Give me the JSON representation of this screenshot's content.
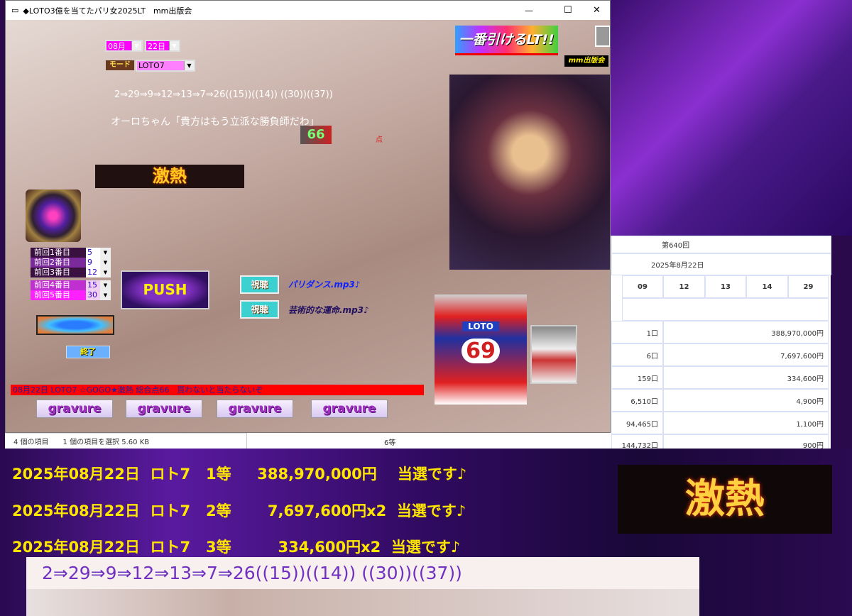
{
  "window": {
    "title": "◆LOTO3億を当てたパリ女2025LT　mm出版会",
    "minimize": "—",
    "maximize": "☐",
    "close": "✕"
  },
  "controls": {
    "month": "08月",
    "day": "22日",
    "mode_label": "モード",
    "mode": "LOTO7"
  },
  "sequence_text": "2⇒29⇒9⇒12⇒13⇒7⇒26((15))((14)) ((30))((37))",
  "speech": "オーロちゃん「貴方はもう立派な勝負師だわ」",
  "score": {
    "value": "66",
    "unit": "点"
  },
  "banner_hot": "激熱",
  "logo": {
    "text": "一番引けるLT!!",
    "publisher": "mm出版会"
  },
  "previous": [
    {
      "label": "前回1番目",
      "value": "5",
      "color": "#3a1040"
    },
    {
      "label": "前回2番目",
      "value": "9",
      "color": "#7a2a9a"
    },
    {
      "label": "前回3番目",
      "value": "12",
      "color": "#3a1040"
    },
    {
      "label": "前回4番目",
      "value": "15",
      "color": "#c030d0"
    },
    {
      "label": "前回5番目",
      "value": "30",
      "color": "#ff20ff"
    }
  ],
  "push_label": "PUSH",
  "listen": [
    {
      "button": "視聴",
      "track": "パリダンス.mp3♪"
    },
    {
      "button": "視聴",
      "track": "芸術的な運命.mp3♪"
    }
  ],
  "exit_label": "終了",
  "ticker": "08月22日 LOTO7 ☆GOGO★激熱 総合点66　買わないと当たらないぞ",
  "gravure": [
    "gravure",
    "gravure",
    "gravure",
    "gravure"
  ],
  "slot_text": "LOTO",
  "slot_number": "69",
  "status_bar": {
    "items": "4 個の項目",
    "selected": "1 個の項目を選択  5.60 KB"
  },
  "results": {
    "round": "第640回",
    "date": "2025年8月22日",
    "numbers": [
      "09",
      "12",
      "13",
      "14",
      "29"
    ],
    "prizes": [
      {
        "count": "1口",
        "amount": "388,970,000円"
      },
      {
        "count": "6口",
        "amount": "7,697,600円"
      },
      {
        "count": "159口",
        "amount": "334,600円"
      },
      {
        "count": "6,510口",
        "amount": "4,900円"
      },
      {
        "count": "94,465口",
        "amount": "1,100円"
      },
      {
        "label": "6等",
        "count": "144,732口",
        "amount": "900円"
      }
    ]
  },
  "winners": [
    "2025年08月22日  ロト7   1等     388,970,000円    当選です♪",
    "2025年08月22日  ロト7   2等       7,697,600円x2  当選です♪",
    "2025年08月22日  ロト7   3等         334,600円x2  当選です♪"
  ],
  "bottom_sequence": "2⇒29⇒9⇒12⇒13⇒7⇒26((15))((14)) ((30))((37))"
}
